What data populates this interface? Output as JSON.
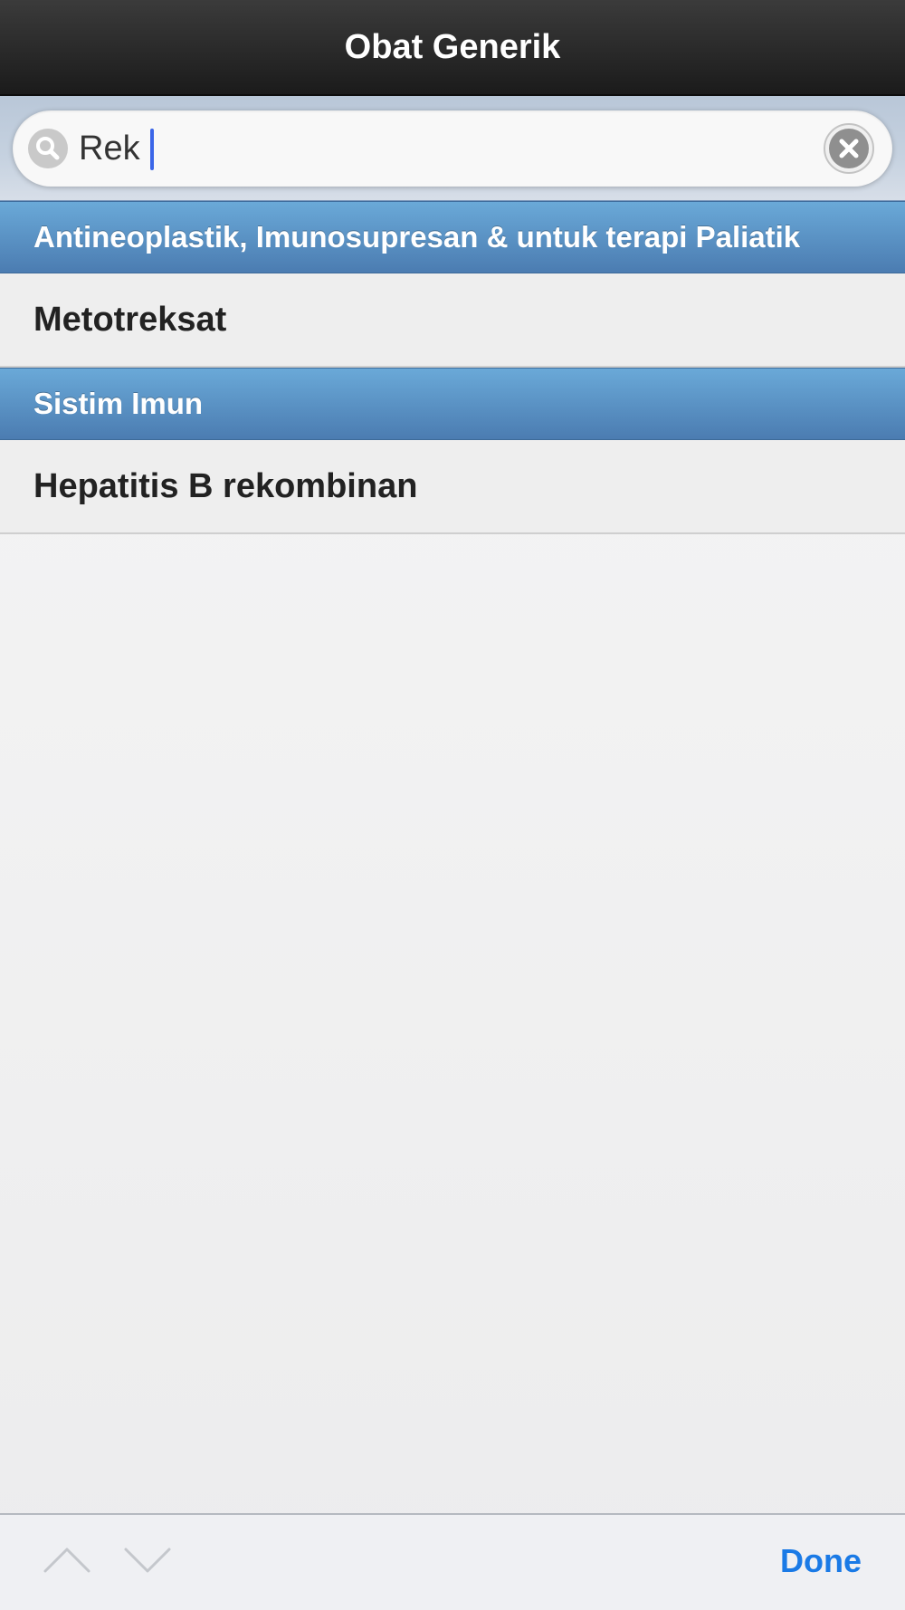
{
  "header": {
    "title": "Obat Generik"
  },
  "search": {
    "value": "Rek",
    "icon": "search-icon",
    "clear_icon": "clear-icon"
  },
  "results": [
    {
      "section": "Antineoplastik, Imunosupresan & untuk terapi Paliatik",
      "items": [
        "Metotreksat"
      ]
    },
    {
      "section": "Sistim Imun",
      "items": [
        "Hepatitis B rekombinan"
      ]
    }
  ],
  "toolbar": {
    "prev_icon": "chevron-up-icon",
    "next_icon": "chevron-down-icon",
    "done_label": "Done"
  },
  "colors": {
    "section_header": "#4b7cb1",
    "done": "#1a7ae6",
    "caret": "#3b66e8"
  }
}
